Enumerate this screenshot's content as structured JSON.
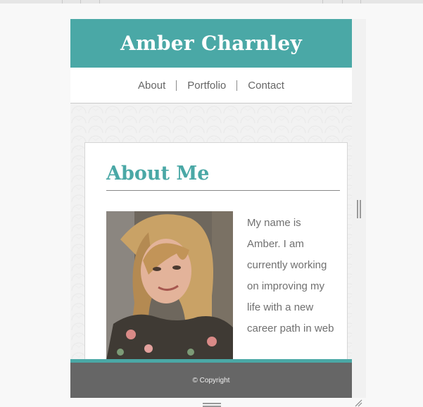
{
  "site": {
    "title": "Amber Charnley"
  },
  "nav": {
    "items": [
      {
        "label": "About"
      },
      {
        "label": "Portfolio"
      },
      {
        "label": "Contact"
      }
    ]
  },
  "about": {
    "heading": "About Me",
    "bio": "My name is Amber. I am currently working on improving my life with a new career path in web"
  },
  "footer": {
    "copyright": "© Copyright"
  },
  "colors": {
    "accent": "#4aa8a6",
    "footer_bg": "#666666",
    "text_gray": "#707070"
  },
  "icons": {
    "right_handle": "vertical-drag-handle-icon",
    "bottom_handle": "horizontal-drag-handle-icon",
    "corner": "resize-corner-icon"
  }
}
